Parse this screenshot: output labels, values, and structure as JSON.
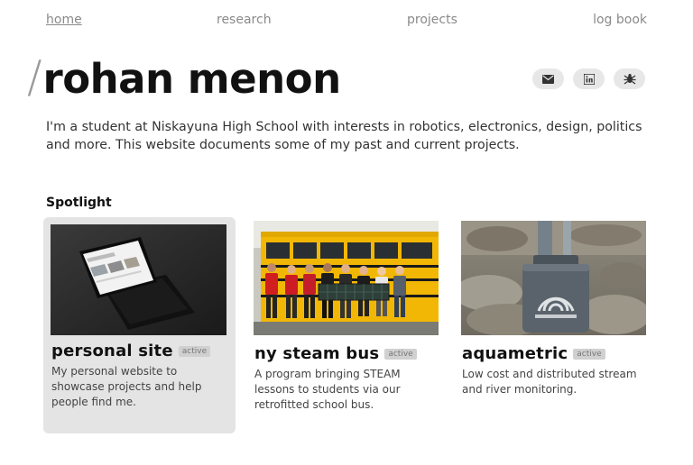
{
  "nav": {
    "items": [
      {
        "label": "home",
        "active": true
      },
      {
        "label": "research"
      },
      {
        "label": "projects"
      },
      {
        "label": "log book"
      }
    ]
  },
  "header": {
    "slash": "/",
    "title": "rohan menon"
  },
  "socials": [
    {
      "icon": "mail-icon"
    },
    {
      "icon": "linkedin-icon"
    },
    {
      "icon": "bug-icon"
    }
  ],
  "intro": "I'm a student at Niskayuna High School with interests in robotics, electronics, design, politics and more. This website documents some of my past and current projects.",
  "spotlight": {
    "heading": "Spotlight",
    "cards": [
      {
        "name": "personal site",
        "badge": "active",
        "description": "My personal website to showcase projects and help people find me.",
        "image": "laptop-photo"
      },
      {
        "name": "ny steam bus",
        "badge": "active",
        "description": "A program bringing STEAM lessons to students via our retrofitted school bus.",
        "image": "school-bus-photo"
      },
      {
        "name": "aquametric",
        "badge": "active",
        "description": "Low cost and distributed stream and river monitoring.",
        "image": "river-sensor-photo"
      }
    ]
  },
  "colors": {
    "card_highlight": "#e4e4e4",
    "badge_bg": "#d0d0d0",
    "social_bg": "#e7e7e7",
    "bus_yellow": "#f2b705"
  }
}
